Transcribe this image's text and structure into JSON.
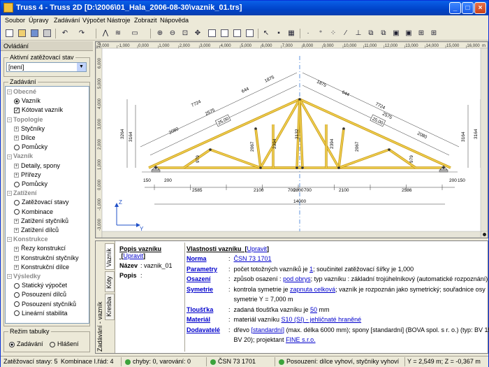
{
  "window": {
    "title": "Truss 4 - Truss 2D [D:\\2006\\01_Hala_2006-08-30\\vaznik_01.trs]"
  },
  "menu": [
    "Soubor",
    "Úpravy",
    "Zadávání",
    "Výpočet",
    "Nástroje",
    "Zobrazit",
    "Nápověda"
  ],
  "left_panel": {
    "header": "Ovládání",
    "load_state_label": "Aktivní zatěžovací stav",
    "load_state_value": "[není]",
    "input_group_label": "Zadávání",
    "tree": [
      {
        "type": "h",
        "label": "Obecné"
      },
      {
        "type": "i",
        "icon": "radio-on",
        "label": "Vazník"
      },
      {
        "type": "i",
        "icon": "check",
        "label": "Kótovat vazník"
      },
      {
        "type": "h",
        "label": "Topologie"
      },
      {
        "type": "i",
        "icon": "plus",
        "label": "Styčníky"
      },
      {
        "type": "i",
        "icon": "plus",
        "label": "Dílce"
      },
      {
        "type": "i",
        "icon": "radio",
        "label": "Pomůcky"
      },
      {
        "type": "h",
        "label": "Vazník"
      },
      {
        "type": "i",
        "icon": "plus",
        "label": "Detaily, spony"
      },
      {
        "type": "i",
        "icon": "plus",
        "label": "Přířezy"
      },
      {
        "type": "i",
        "icon": "radio",
        "label": "Pomůcky"
      },
      {
        "type": "h",
        "label": "Zatížení"
      },
      {
        "type": "i",
        "icon": "radio",
        "label": "Zatěžovací stavy"
      },
      {
        "type": "i",
        "icon": "radio",
        "label": "Kombinace"
      },
      {
        "type": "i",
        "icon": "plus",
        "label": "Zatížení styčníků"
      },
      {
        "type": "i",
        "icon": "plus",
        "label": "Zatížení dílců"
      },
      {
        "type": "h",
        "label": "Konstrukce"
      },
      {
        "type": "i",
        "icon": "plus",
        "label": "Řezy konstrukcí"
      },
      {
        "type": "i",
        "icon": "plus",
        "label": "Konstrukční styčníky"
      },
      {
        "type": "i",
        "icon": "plus",
        "label": "Konstrukční dílce"
      },
      {
        "type": "h",
        "label": "Výsledky"
      },
      {
        "type": "i",
        "icon": "radio",
        "label": "Statický výpočet"
      },
      {
        "type": "i",
        "icon": "radio",
        "label": "Posouzení dílců"
      },
      {
        "type": "i",
        "icon": "radio",
        "label": "Posouzení styčníků"
      },
      {
        "type": "i",
        "icon": "radio",
        "label": "Lineární stabilita"
      }
    ],
    "table_mode_label": "Režim tabulky",
    "mode_input": "Zadávání",
    "mode_report": "Hlášení"
  },
  "drawing": {
    "ruler_labels": [
      "-2,000",
      "-1,000",
      "0,000",
      "1,000",
      "2,000",
      "3,000",
      "4,000",
      "5,000",
      "6,000",
      "7,000",
      "8,000",
      "9,000",
      "10,000",
      "11,000",
      "12,000",
      "13,000",
      "14,000",
      "15,000",
      "16,000"
    ],
    "ruler_unit": "m",
    "dims_bottom": [
      "150",
      "200",
      "2585",
      "2100",
      "700",
      "2800",
      "700",
      "2100",
      "2586",
      "200",
      "150"
    ],
    "dim_total": "14000",
    "dims_top_left": [
      "7724",
      "2575",
      "644",
      "1875",
      "2080"
    ],
    "dims_top_right": [
      "1875",
      "644",
      "7724",
      "2575",
      "2080"
    ],
    "dims_vert": [
      "3264",
      "3164",
      "979",
      "2067",
      "2394",
      "3132",
      "2394",
      "2067",
      "979",
      "3164",
      "3164"
    ],
    "slope": "25,00",
    "axis_y": "Y",
    "axis_z": "Z"
  },
  "bottom": {
    "tabs": [
      "Vazník",
      "Kóty",
      "Kresba"
    ],
    "main_tab": "Zadávání - vazník",
    "popis_title": "Popis vazníku",
    "edit": "Upravit",
    "name_label": "Název",
    "name_value": "vaznik_01",
    "popis_label": "Popis",
    "props_title": "Vlastnosti vazníku",
    "rows": [
      {
        "k": "Norma",
        "v_pre": "",
        "link": "ČSN 73 1701",
        "v_post": ""
      },
      {
        "k": "Parametry",
        "v_pre": "počet totožných vazníků je ",
        "link": "1",
        "v_post": "; součinitel zatěžovací šířky je 1,000"
      },
      {
        "k": "Osazení",
        "v_pre": "způsob osazení : ",
        "link": "pod obrys",
        "v_post": "; typ vazníku : základní trojúhelníkový (automatické rozpoznání)"
      },
      {
        "k": "Symetrie",
        "v_pre": "kontrola symetrie je ",
        "link": "zapnuta celková",
        "v_post": "; vazník je rozpoznán jako symetrický; souřadnice osy"
      },
      {
        "k": "",
        "v_pre": "symetrie Y = 7,000 m",
        "link": "",
        "v_post": ""
      },
      {
        "k": "Tloušťka",
        "v_pre": "zadaná tloušťka vazníku je ",
        "link": "50",
        "v_post": " mm"
      },
      {
        "k": "Materiál",
        "v_pre": "materiál vazníku ",
        "link": "S10 (SI) - jehličnaté hraněné",
        "v_post": ""
      },
      {
        "k": "Dodavatelé",
        "v_pre": "dřevo ",
        "link": "[standardní]",
        "v_post": " (max. délka 6000 mm); spony [standardní] (BOVA spol. s r. o.) (typ: BV 15,"
      },
      {
        "k": "",
        "v_pre": "BV 20); projektant ",
        "link": "FINE s.r.o.",
        "v_post": ""
      }
    ]
  },
  "status": {
    "load_states": "Zatěžovací stavy: 5",
    "combination": "Kombinace I.řád: 4",
    "errors": "chyby: 0, varování: 0",
    "norm": "ČSN 73 1701",
    "assessment": "Posouzení: dílce vyhoví, styčníky vyhoví",
    "coords": "Y = 2,549 m; Z = -0,367 m"
  }
}
